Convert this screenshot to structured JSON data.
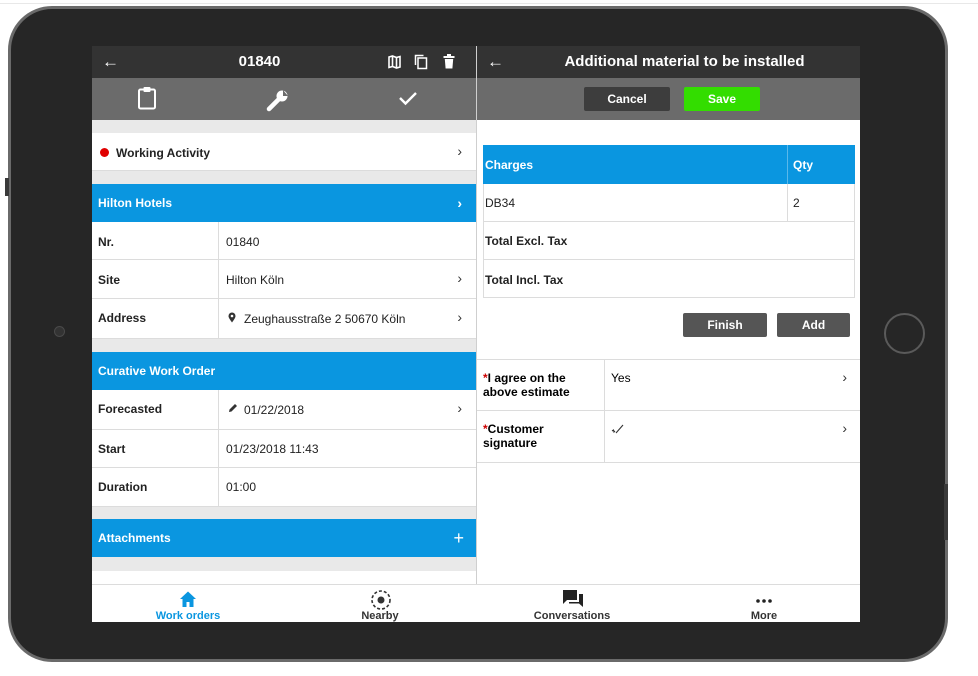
{
  "left_panel": {
    "header": {
      "back_icon": "←",
      "title": "01840"
    },
    "header_icons": [
      "map-icon",
      "copy-icon",
      "trash-icon"
    ],
    "toolbar_icons": [
      "clipboard-icon",
      "wrench-icon",
      "check-icon"
    ],
    "status_row": {
      "label": "Working Activity",
      "dot_color": "#e00000"
    },
    "section_customer": {
      "title": "Hilton Hotels"
    },
    "fields": [
      {
        "label": "Nr.",
        "value": "01840"
      },
      {
        "label": "Site",
        "value": "Hilton Köln"
      },
      {
        "label": "Address",
        "value": "Zeughausstraße 2 50670 Köln"
      }
    ],
    "section_workorder": {
      "title": "Curative Work Order"
    },
    "workorder_fields": [
      {
        "label": "Forecasted",
        "value": "01/22/2018"
      },
      {
        "label": "Start",
        "value": "01/23/2018 11:43"
      },
      {
        "label": "Duration",
        "value": "01:00"
      }
    ],
    "section_attachments": {
      "title": "Attachments",
      "action": "+"
    }
  },
  "right_panel": {
    "header": {
      "back_icon": "←",
      "title": "Additional material to be installed"
    },
    "cancel_label": "Cancel",
    "save_label": "Save",
    "table": {
      "headers": [
        "Charges",
        "Qty"
      ],
      "rows": [
        [
          "DB34",
          "2"
        ]
      ],
      "total_excl_label": "Total Excl. Tax",
      "total_incl_label": "Total Incl. Tax"
    },
    "finish_label": "Finish",
    "add_label": "Add",
    "agree": {
      "required": "*",
      "label": "I agree on the above estimate",
      "value": "Yes"
    },
    "signature": {
      "required": "*",
      "label": "Customer signature"
    }
  },
  "navbar": {
    "items": [
      {
        "label": "Work orders",
        "icon": "home-icon",
        "active": true
      },
      {
        "label": "Nearby",
        "icon": "target-icon",
        "active": false
      },
      {
        "label": "Conversations",
        "icon": "chat-icon",
        "active": false
      },
      {
        "label": "More",
        "icon": "more-icon",
        "active": false
      }
    ]
  },
  "colors": {
    "accent": "#0a96e0",
    "header_bg": "#333333",
    "toolbar_bg": "#6b6b6b",
    "save_green": "#33dd00",
    "required_red": "#cc0000"
  }
}
